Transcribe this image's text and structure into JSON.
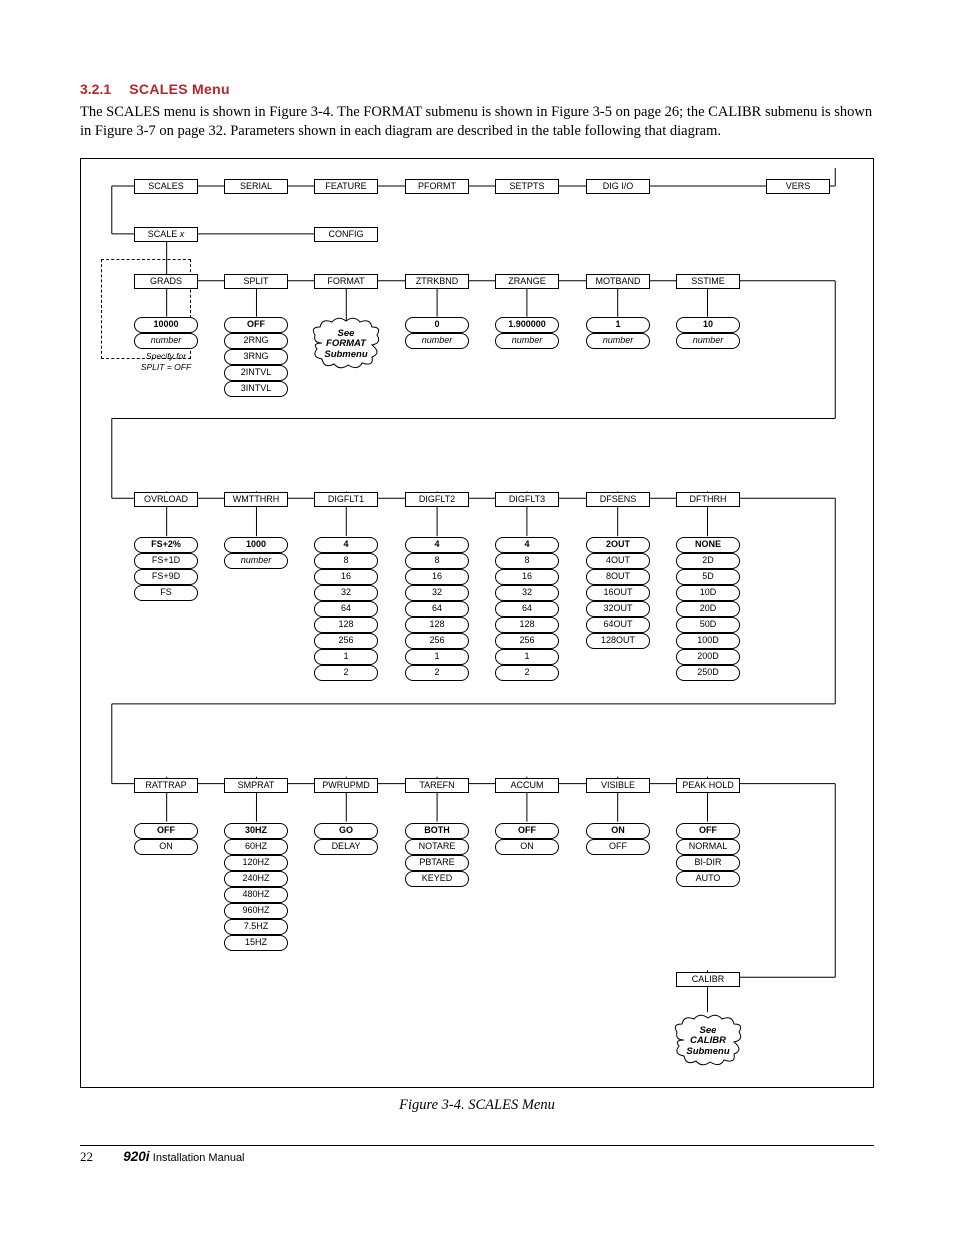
{
  "heading": {
    "num": "3.2.1",
    "title": "SCALES Menu"
  },
  "body": "The SCALES menu is shown in Figure 3-4. The FORMAT submenu is shown in Figure 3-5 on page 26; the CALIBR submenu is shown in Figure 3-7 on page 32. Parameters shown in each diagram are described in the table following that diagram.",
  "caption": "Figure 3-4. SCALES Menu",
  "footer": {
    "page": "22",
    "model": "920i",
    "manual": "Installation Manual"
  },
  "top_menu": [
    "SCALES",
    "SERIAL",
    "FEATURE",
    "PFORMT",
    "SETPTS",
    "DIG I/O",
    "VERS"
  ],
  "row2": {
    "scalex": "SCALE x",
    "config": "CONFIG"
  },
  "row3_params": [
    "GRADS",
    "SPLIT",
    "FORMAT",
    "ZTRKBND",
    "ZRANGE",
    "MOTBAND",
    "SSTIME"
  ],
  "grads": {
    "default": "10000",
    "sub": "number",
    "note1": "Specify for",
    "note2": "SPLIT = OFF"
  },
  "split": {
    "default": "OFF",
    "opts": [
      "2RNG",
      "3RNG",
      "2INTVL",
      "3INTVL"
    ]
  },
  "format_note": "See FORMAT Submenu",
  "ztrkbnd": {
    "default": "0",
    "sub": "number"
  },
  "zrange": {
    "default": "1.900000",
    "sub": "number"
  },
  "motband": {
    "default": "1",
    "sub": "number"
  },
  "sstime": {
    "default": "10",
    "sub": "number"
  },
  "row4_params": [
    "OVRLOAD",
    "WMTTHRH",
    "DIGFLT1",
    "DIGFLT2",
    "DIGFLT3",
    "DFSENS",
    "DFTHRH"
  ],
  "ovrload": {
    "default": "FS+2%",
    "opts": [
      "FS+1D",
      "FS+9D",
      "FS"
    ]
  },
  "wmtthrh": {
    "default": "1000",
    "sub": "number"
  },
  "digflt_default": "4",
  "digflt_opts": [
    "8",
    "16",
    "32",
    "64",
    "128",
    "256",
    "1",
    "2"
  ],
  "dfsens": {
    "default": "2OUT",
    "opts": [
      "4OUT",
      "8OUT",
      "16OUT",
      "32OUT",
      "64OUT",
      "128OUT"
    ]
  },
  "dfthrh": {
    "default": "NONE",
    "opts": [
      "2D",
      "5D",
      "10D",
      "20D",
      "50D",
      "100D",
      "200D",
      "250D"
    ]
  },
  "row5_params": [
    "RATTRAP",
    "SMPRAT",
    "PWRUPMD",
    "TAREFN",
    "ACCUM",
    "VISIBLE",
    "PEAK HOLD"
  ],
  "rattrap": {
    "default": "OFF",
    "opts": [
      "ON"
    ]
  },
  "smprat": {
    "default": "30HZ",
    "opts": [
      "60HZ",
      "120HZ",
      "240HZ",
      "480HZ",
      "960HZ",
      "7.5HZ",
      "15HZ"
    ]
  },
  "pwrupmd": {
    "default": "GO",
    "opts": [
      "DELAY"
    ]
  },
  "tarefn": {
    "default": "BOTH",
    "opts": [
      "NOTARE",
      "PBTARE",
      "KEYED"
    ]
  },
  "accum": {
    "default": "OFF",
    "opts": [
      "ON"
    ]
  },
  "visible": {
    "default": "ON",
    "opts": [
      "OFF"
    ]
  },
  "peakhold": {
    "default": "OFF",
    "opts": [
      "NORMAL",
      "BI-DIR",
      "AUTO"
    ]
  },
  "calibr": {
    "label": "CALIBR",
    "note": "See CALIBR Submenu"
  }
}
